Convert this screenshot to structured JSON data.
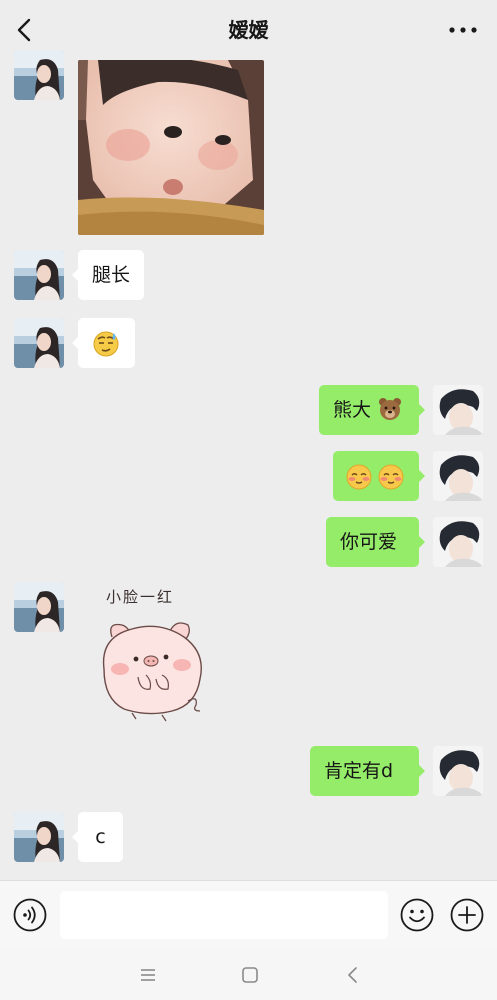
{
  "header": {
    "title": "嫒嫒",
    "back_icon": "chevron-left-icon",
    "more_icon": "more-dots-icon"
  },
  "messages": [
    {
      "side": "in",
      "type": "image",
      "content": "baby-photo"
    },
    {
      "side": "in",
      "type": "text",
      "text": "腿长"
    },
    {
      "side": "in",
      "type": "emoji",
      "content": "sweat-smile-emoji"
    },
    {
      "side": "out",
      "type": "text",
      "text": "熊大",
      "emoji": "bear-face-emoji"
    },
    {
      "side": "out",
      "type": "emoji",
      "content": "blushing-face-emoji x2"
    },
    {
      "side": "out",
      "type": "text",
      "text": "你可爱"
    },
    {
      "side": "in",
      "type": "sticker",
      "caption": "小脸一红"
    },
    {
      "side": "out",
      "type": "text",
      "text": "肯定有d"
    },
    {
      "side": "in",
      "type": "text",
      "text": "c"
    }
  ],
  "input": {
    "value": "",
    "voice_icon": "voice-icon",
    "emoji_icon": "smiley-icon",
    "plus_icon": "plus-icon"
  },
  "colors": {
    "background": "#ededed",
    "outgoing_bubble": "#95ec69",
    "incoming_bubble": "#ffffff"
  }
}
